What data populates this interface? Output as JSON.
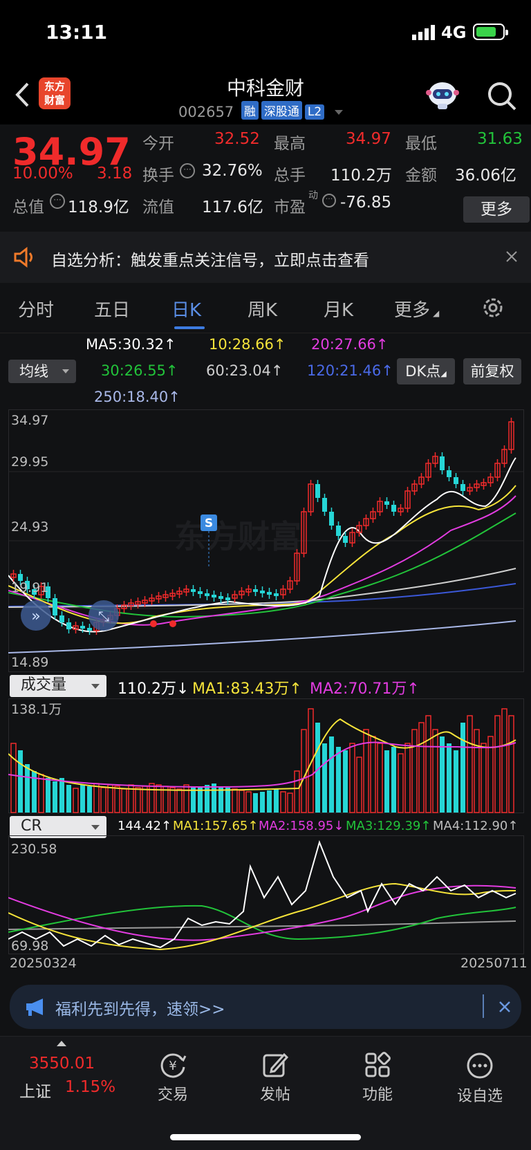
{
  "status": {
    "time": "13:11",
    "network": "4G"
  },
  "header": {
    "logo_line1": "东方",
    "logo_line2": "财富",
    "title": "中科金财",
    "code": "002657",
    "tags": [
      "融",
      "深股通",
      "L2"
    ]
  },
  "quote": {
    "price": "34.97",
    "change_pct": "10.00%",
    "change": "3.18",
    "open_label": "今开",
    "open": "32.52",
    "high_label": "最高",
    "high": "34.97",
    "low_label": "最低",
    "low": "31.63",
    "turnover_label": "换手",
    "turnover": "32.76%",
    "volume_label": "总手",
    "volume": "110.2万",
    "amount_label": "金额",
    "amount": "36.06亿",
    "mcap_label": "总值",
    "mcap": "118.9亿",
    "float_label": "流值",
    "float": "117.6亿",
    "pe_label": "市盈",
    "pe_sup": "动",
    "pe": "-76.85",
    "more_label": "更多"
  },
  "notice": {
    "text": "自选分析：触发重点关注信号，立即点击查看"
  },
  "tabs": [
    "分时",
    "五日",
    "日K",
    "周K",
    "月K",
    "更多"
  ],
  "ma": {
    "ma5": "MA5:30.32↑",
    "ma10": "10:28.66↑",
    "ma20": "20:27.66↑",
    "ma30": "30:26.55↑",
    "ma60": "60:23.04↑",
    "ma120": "120:21.46↑",
    "ma250": "250:18.40↑",
    "selector": "均线",
    "dk_label": "DK点",
    "adjust_label": "前复权"
  },
  "price_axis": [
    "34.97",
    "29.95",
    "24.93",
    "19.91",
    "14.89"
  ],
  "s_marker": "S",
  "volume": {
    "selector": "成交量",
    "current": "110.2万↓",
    "ma1": "MA1:83.43万↑",
    "ma2": "MA2:70.71万↑",
    "axis_top": "138.1万"
  },
  "cr": {
    "selector": "CR",
    "current": "144.42↑",
    "ma1": "MA1:157.65↑",
    "ma2": "MA2:158.95↓",
    "ma3": "MA3:129.39↑",
    "ma4": "MA4:112.90↑",
    "axis_top": "230.58",
    "axis_bottom": "69.98"
  },
  "dates": {
    "start": "20250324",
    "end": "20250711"
  },
  "banner": {
    "text": "福利先到先得，速领>>"
  },
  "bottom": {
    "index_value": "3550.01",
    "index_name": "上证",
    "index_pct": "1.15%",
    "trade": "交易",
    "post": "发帖",
    "features": "功能",
    "watchlist": "设自选"
  },
  "colors": {
    "up": "#f02b2b",
    "down": "#26d6d6",
    "ma5": "#ffffff",
    "ma10": "#f5e33a",
    "ma20": "#e23ce0",
    "ma30": "#22c33a",
    "ma60": "#cfcfcf",
    "ma120": "#3b58d8",
    "ma250": "#a9b8e8"
  }
}
